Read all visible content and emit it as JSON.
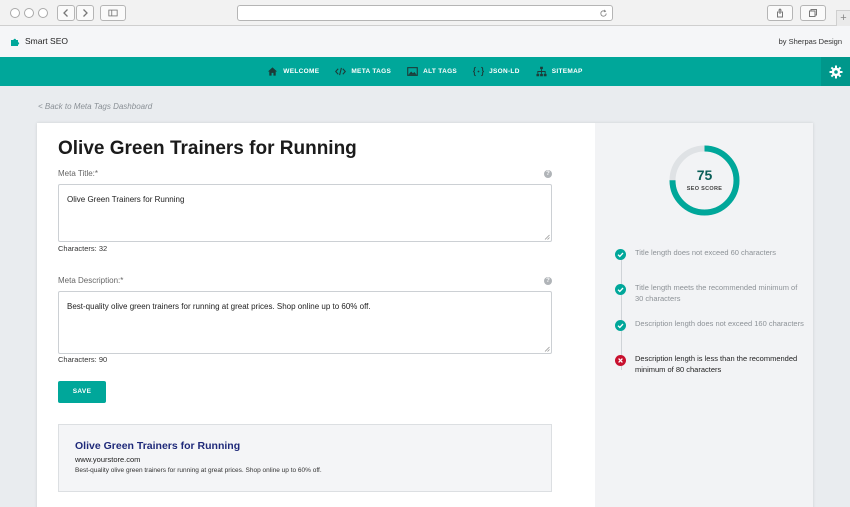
{
  "app": {
    "name": "Smart SEO",
    "byline": "by Sherpas Design"
  },
  "nav": {
    "items": [
      {
        "label": "WELCOME",
        "icon": "home-icon"
      },
      {
        "label": "META TAGS",
        "icon": "code-icon"
      },
      {
        "label": "ALT TAGS",
        "icon": "image-icon"
      },
      {
        "label": "JSON-LD",
        "icon": "json-icon"
      },
      {
        "label": "SITEMAP",
        "icon": "sitemap-icon"
      }
    ]
  },
  "back_link": "< Back to Meta Tags Dashboard",
  "page": {
    "title": "Olive Green Trainers for Running",
    "meta_title_label": "Meta Title:*",
    "meta_title_value": "Olive Green Trainers for Running",
    "meta_title_chars": "Characters: 32",
    "meta_desc_label": "Meta Description:*",
    "meta_desc_value": "Best-quality olive green trainers for running at great prices. Shop online up to 60% off.",
    "meta_desc_chars": "Characters: 90",
    "save_label": "SAVE"
  },
  "preview": {
    "title": "Olive Green Trainers for Running",
    "url": "www.yourstore.com",
    "description": "Best-quality olive green trainers for running at great prices. Shop online up to 60% off."
  },
  "score": {
    "value": "75",
    "label": "SEO SCORE",
    "percent": 75
  },
  "checks": [
    {
      "text": "Title length does not exceed 60 characters",
      "status": "pass"
    },
    {
      "text": "Title length meets the recommended minimum of 30 characters",
      "status": "pass"
    },
    {
      "text": "Description length does not exceed 160 characters",
      "status": "pass"
    },
    {
      "text": "Description length is less than the recommended minimum of 80 characters",
      "status": "fail"
    }
  ],
  "colors": {
    "accent": "#00a79a",
    "pass": "#00a79a",
    "fail": "#c8102e"
  }
}
